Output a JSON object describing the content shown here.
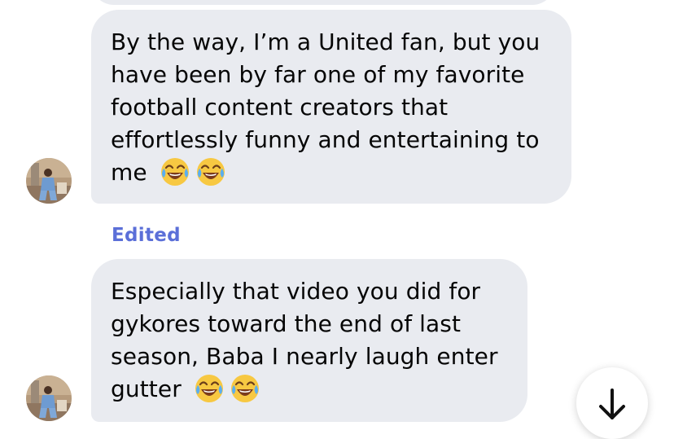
{
  "messages": [
    {
      "text": "By the way, I’m a United fan, but you have been by far one of my favorite football content creators that effortlessly funny and entertaining to me",
      "emojis": [
        "face-with-tears-of-joy",
        "face-with-tears-of-joy"
      ]
    },
    {
      "status": "Edited",
      "text": "Especially that video you did for gykores toward the end of last season, Baba I nearly laugh enter gutter",
      "emojis": [
        "face-with-tears-of-joy",
        "face-with-tears-of-joy"
      ]
    }
  ],
  "colors": {
    "bubble_background": "#e9ebf0",
    "message_text": "#050505",
    "edited_label": "#5b6fd8",
    "background": "#ffffff"
  },
  "icons": {
    "scroll_button": "arrow-down-icon",
    "emoji": "face-with-tears-of-joy-icon",
    "avatar": "profile-photo"
  }
}
